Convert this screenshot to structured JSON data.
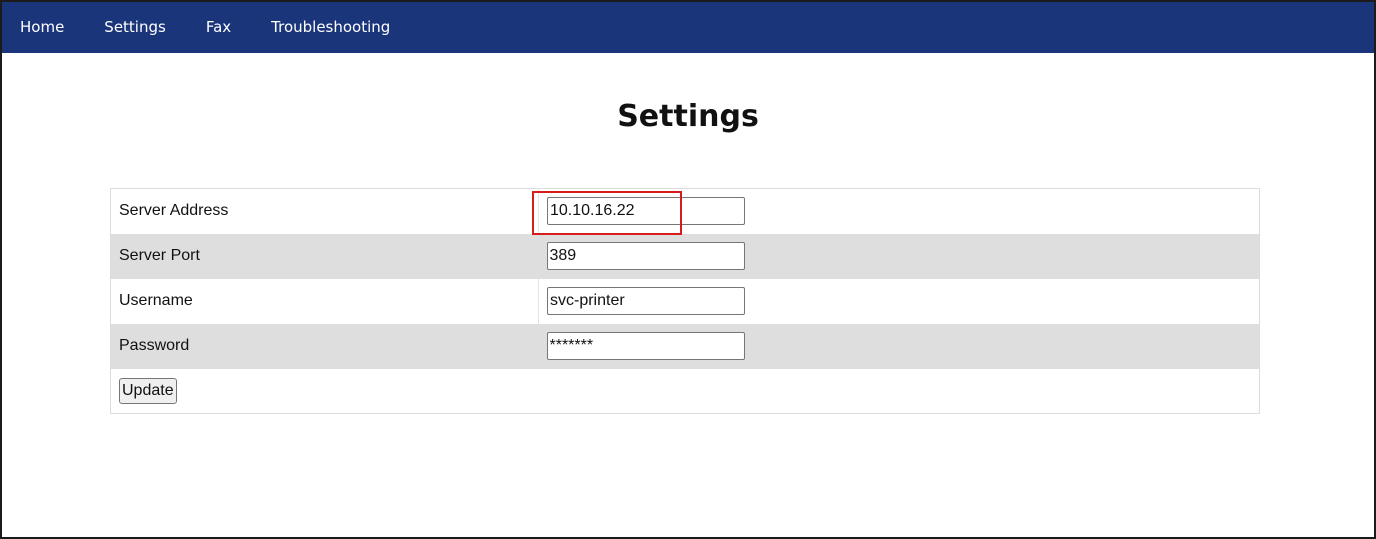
{
  "nav": {
    "items": [
      {
        "label": "Home"
      },
      {
        "label": "Settings"
      },
      {
        "label": "Fax"
      },
      {
        "label": "Troubleshooting"
      }
    ]
  },
  "page": {
    "title": "Settings"
  },
  "form": {
    "rows": [
      {
        "label": "Server Address",
        "value": "10.10.16.22"
      },
      {
        "label": "Server Port",
        "value": "389"
      },
      {
        "label": "Username",
        "value": "svc-printer"
      },
      {
        "label": "Password",
        "value": "*******"
      }
    ],
    "update_label": "Update"
  },
  "colors": {
    "navbar": "#1b357a",
    "row_shade": "#dedede",
    "highlight": "#d81b1b"
  }
}
